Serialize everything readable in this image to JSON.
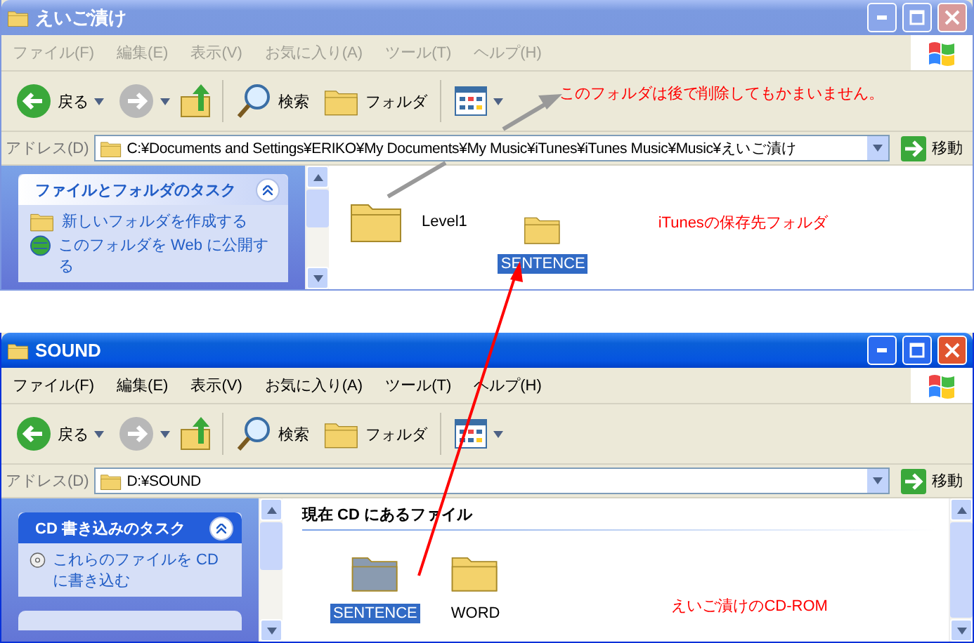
{
  "windows": [
    {
      "title": "えいご漬け",
      "active": false,
      "menu": [
        "ファイル(F)",
        "編集(E)",
        "表示(V)",
        "お気に入り(A)",
        "ツール(T)",
        "ヘルプ(H)"
      ],
      "toolbar": {
        "back": "戻る",
        "search": "検索",
        "folders": "フォルダ",
        "note": "このフォルダは後で削除してもかまいません。"
      },
      "address": {
        "label": "アドレス(D)",
        "value": "C:¥Documents and Settings¥ERIKO¥My Documents¥My Music¥iTunes¥iTunes Music¥Music¥えいご漬け",
        "go": "移動"
      },
      "tasks": {
        "kind": "normal",
        "title": "ファイルとフォルダのタスク",
        "items": [
          "新しいフォルダを作成する",
          "このフォルダを Web に公開する"
        ]
      },
      "content": {
        "items": [
          {
            "name": "Level1",
            "kind": "tile",
            "selected": false,
            "color": "#f3d26b"
          },
          {
            "name": "SENTENCE",
            "kind": "icon",
            "selected": true,
            "color": "#f3d26b"
          }
        ],
        "note": "iTunesの保存先フォルダ"
      }
    },
    {
      "title": "SOUND",
      "active": true,
      "menu": [
        "ファイル(F)",
        "編集(E)",
        "表示(V)",
        "お気に入り(A)",
        "ツール(T)",
        "ヘルプ(H)"
      ],
      "toolbar": {
        "back": "戻る",
        "search": "検索",
        "folders": "フォルダ"
      },
      "address": {
        "label": "アドレス(D)",
        "value": "D:¥SOUND",
        "go": "移動"
      },
      "tasks": {
        "kind": "special",
        "title": "CD 書き込みのタスク",
        "items": [
          "これらのファイルを CD に書き込む"
        ]
      },
      "content": {
        "heading": "現在 CD にあるファイル",
        "items": [
          {
            "name": "SENTENCE",
            "kind": "icon",
            "selected": true,
            "color": "#8a9bb0"
          },
          {
            "name": "WORD",
            "kind": "icon",
            "selected": false,
            "color": "#f3d26b"
          }
        ],
        "note": "えいご漬けのCD-ROM"
      }
    }
  ]
}
